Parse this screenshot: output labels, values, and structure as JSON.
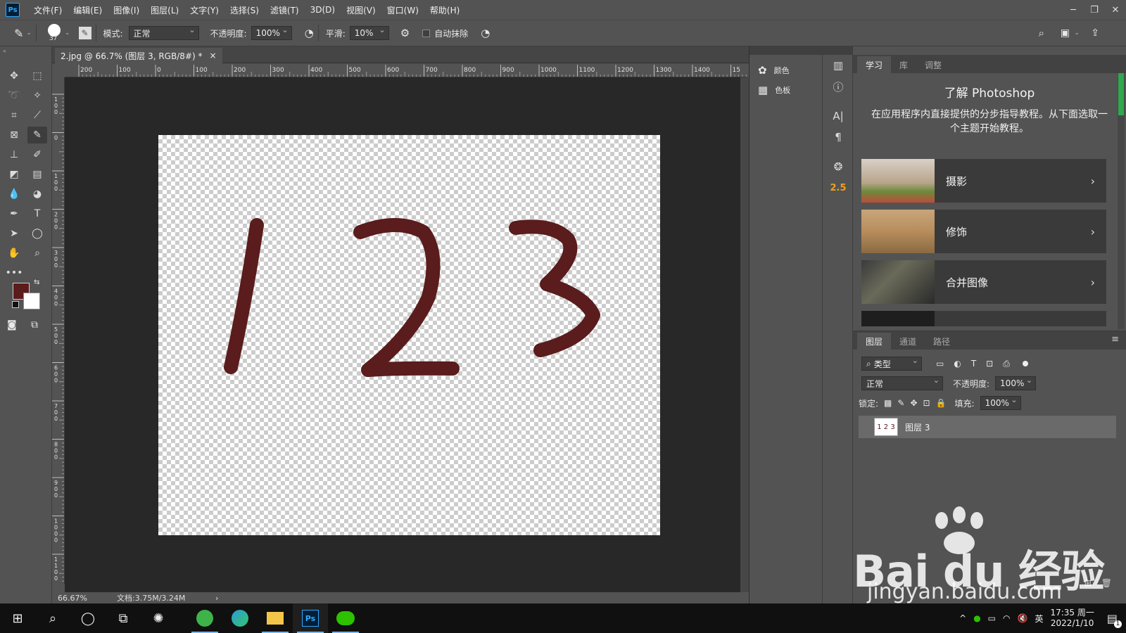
{
  "app": {
    "logo": "Ps",
    "menus": [
      "文件(F)",
      "编辑(E)",
      "图像(I)",
      "图层(L)",
      "文字(Y)",
      "选择(S)",
      "滤镜(T)",
      "3D(D)",
      "视图(V)",
      "窗口(W)",
      "帮助(H)"
    ]
  },
  "options": {
    "brush_size": "37",
    "mode_label": "模式:",
    "mode_value": "正常",
    "opacity_label": "不透明度:",
    "opacity_value": "100%",
    "smooth_label": "平滑:",
    "smooth_value": "10%",
    "auto_erase_label": "自动抹除"
  },
  "document": {
    "tab_title": "2.jpg @ 66.7% (图层 3, RGB/8#) *",
    "close": "×",
    "ruler_top_labels": [
      "200",
      "100",
      "0",
      "100",
      "200",
      "300",
      "400",
      "500",
      "600",
      "700",
      "800",
      "900",
      "1000",
      "1100",
      "1200",
      "1300",
      "1400",
      "15"
    ],
    "ruler_left_labels": [
      "1\n0\n0",
      "0",
      "1\n0\n0",
      "2\n0\n0",
      "3\n0\n0",
      "4\n0\n0",
      "5\n0\n0",
      "6\n0\n0",
      "7\n0\n0",
      "8\n0\n0",
      "9\n0\n0",
      "1\n0\n0\n0",
      "1\n1\n0\n0"
    ],
    "zoom": "66.67%",
    "doc_info": "文档:3.75M/3.24M",
    "status_arrow": "›"
  },
  "colors": {
    "foreground": "#5c1c1c",
    "background": "#ffffff",
    "stroke": "#5a1c1c"
  },
  "mid_panel": {
    "items": [
      {
        "icon": "color-wheel-icon",
        "label": "颜色"
      },
      {
        "icon": "swatches-grid-icon",
        "label": "色板"
      }
    ],
    "strip_value": "2.5"
  },
  "learn": {
    "tabs": [
      "学习",
      "库",
      "调整"
    ],
    "title": "了解 Photoshop",
    "description": "在应用程序内直接提供的分步指导教程。从下面选取一个主题开始教程。",
    "cards": [
      "摄影",
      "修饰",
      "合并图像"
    ]
  },
  "layers": {
    "tabs": [
      "图层",
      "通道",
      "路径"
    ],
    "filter_label": "类型",
    "blend_mode": "正常",
    "opacity_label": "不透明度:",
    "opacity_value": "100%",
    "lock_label": "锁定:",
    "fill_label": "填充:",
    "fill_value": "100%",
    "layer_name": "图层 3",
    "layer_thumb_text": "1 2 3"
  },
  "watermark": {
    "brand": "Bai du 经验",
    "url": "jingyan.baidu.com"
  },
  "taskbar": {
    "ime": "英",
    "time": "17:35 周一",
    "date": "2022/1/10",
    "notify_count": "1",
    "ps_label": "Ps"
  }
}
